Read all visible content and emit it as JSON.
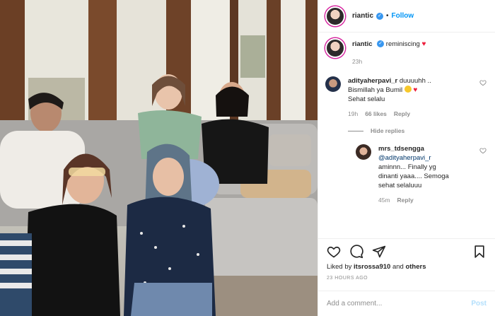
{
  "post": {
    "username": "riantic",
    "follow_label": "Follow",
    "separator": "•",
    "caption": "reminiscing",
    "caption_emoji": "red-heart",
    "caption_time": "23h"
  },
  "comments": [
    {
      "username": "adityaherpavi_r",
      "text_line1": "duuuuhh ..",
      "text_line2": "Bismillah ya Bumil",
      "text_line3": "Sehat selalu",
      "time": "19h",
      "likes": "66 likes",
      "reply_label": "Reply"
    }
  ],
  "hide_replies_label": "Hide replies",
  "reply": {
    "username": "mrs_tdsengga",
    "mention": "@adityaherpavi_r",
    "text_line1": "aminnn... Finally yg",
    "text_line2": "dinanti yaaa.... Semoga",
    "text_line3": "sehat selaluuu",
    "time": "45m",
    "reply_label": "Reply"
  },
  "liked_by": {
    "prefix": "Liked by",
    "user": "itsrossa910",
    "mid": "and",
    "others": "others"
  },
  "timestamp": "23 HOURS AGO",
  "add_comment": {
    "placeholder": "Add a comment...",
    "post_label": "Post"
  },
  "icons": {
    "like": "heart-outline-icon",
    "comment": "comment-bubble-icon",
    "share": "paper-plane-icon",
    "save": "bookmark-icon"
  },
  "colors": {
    "accent": "#0095f6",
    "verified": "#3897f0",
    "heart": "#ed1c3b",
    "muted": "#8e8e8e"
  }
}
